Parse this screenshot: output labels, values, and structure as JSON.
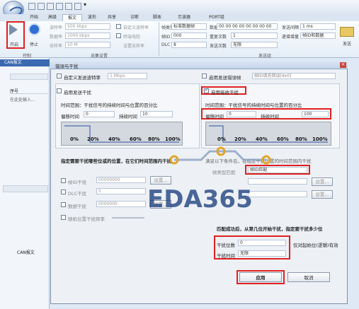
{
  "ribbon": {
    "tabs": [
      "开始",
      "高级",
      "报文",
      "波形",
      "共享",
      "诊断",
      "脚本",
      "示波器",
      "PORT组"
    ],
    "active_tab": "报文",
    "start": "开启",
    "stop": "停止",
    "baud_label": "波特率",
    "baud_value": "500 kbps",
    "data_baud_label": "数据率",
    "data_baud_value": "1000 kbps",
    "sample_label": "采样率",
    "sample_value": "50 M",
    "auto_baud": "自定义波特率",
    "terminal": "终端电阻",
    "sample_point": "设置采样率",
    "frame_type_label": "帧类型",
    "frame_type_value": "标准数据帧",
    "data_label": "数据",
    "data_value": "00 00 00 00 00 00 00 00",
    "id_label": "帧ID",
    "id_value": "000",
    "repeat_label": "重复次数",
    "repeat_value": "1",
    "dlc_label": "DLC",
    "dlc_value": "8",
    "send_count_label": "发送次数",
    "send_count_value": "无限",
    "interval_label": "发送间隔",
    "interval_value": "1 ms",
    "mode_label": "递增增量",
    "mode_value": "帧ID和数据",
    "send": "发送",
    "group_ctrl": "控制",
    "group_sample": "采集设置",
    "group_send": "发送组",
    "can_tab": "CAN报文"
  },
  "left": {
    "header": "序号",
    "placeholder": "在此处输入...",
    "footer": "CAN报文"
  },
  "dialog": {
    "title": "错误与干扰",
    "custom_baud_cb": "自定义发送波特率",
    "custom_baud_value": "1 Mbps",
    "enable_tx_err": "启用发送错误帧",
    "fill_label": "帧ID填充错误[4x0]",
    "send_interfere": "启用发送干扰",
    "recv_interfere": "启用接收干扰",
    "range_desc_l": "时间范围：干扰信号的持续时间与位置的百分比",
    "range_desc_r": "时间范围：干扰信号的持续时间与位置的百分比",
    "offset_l": "偏移时间",
    "offset_l_val": "0",
    "dur_l": "持续时间",
    "dur_l_val": "10",
    "offset_r": "偏移时间",
    "offset_r_val": "0",
    "dur_r": "持续时间",
    "dur_r_val": "100",
    "ticks": [
      "0%",
      "20%",
      "40%",
      "60%",
      "80%",
      "100%"
    ],
    "pos_desc_l": "指定需要干扰哪些位或的位置，在它们时间范围内干扰",
    "pos_desc_r": "满足以下条件后，在指定干扰位置的时间范围内干扰",
    "frame_id": "帧ID干扰",
    "frame_id_val": "00000000",
    "dlc": "DLC干扰",
    "dlc_val": "0",
    "data": "数据干扰",
    "data_val": "0000000",
    "random": "随机位置干扰频率",
    "settings": "设置...",
    "cond_label": "帧类型匹配",
    "cond_val": "帧ID匹配",
    "bits_label": "匹配成功后，从第几位开始干扰，指定要干扰多少位",
    "start_bit_label": "干扰位数",
    "start_bit_val": "0",
    "start_bit_hint": "仅对起始位(逻辑)有效",
    "time_label": "干扰时间",
    "time_val": "无限",
    "apply": "应用",
    "cancel": "取消"
  },
  "watermark": "EDA365",
  "colors": {
    "highlight": "#e02020",
    "accent": "#2f5fae"
  }
}
